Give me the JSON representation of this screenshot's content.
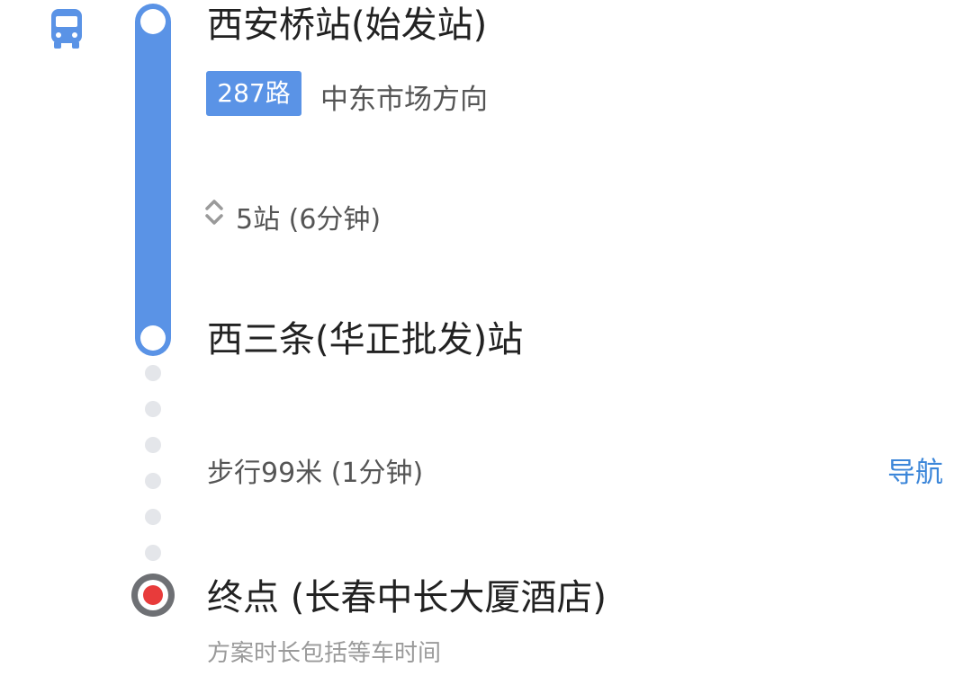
{
  "route": {
    "start_station": "西安桥站(始发站)",
    "line_badge": "287路",
    "direction": "中东市场方向",
    "stops_info": "5站 (6分钟)",
    "end_station": "西三条(华正批发)站",
    "walk_info": "步行99米 (1分钟)",
    "nav_label": "导航",
    "destination": "终点 (长春中长大厦酒店)",
    "footnote": "方案时长包括等车时间"
  },
  "icons": {
    "transport": "bus-icon",
    "expand": "chevron-up-down-icon",
    "destination": "destination-marker-icon"
  },
  "colors": {
    "accent": "#5a93e6",
    "link": "#3b86d9",
    "destination_dot": "#e83b3b"
  }
}
